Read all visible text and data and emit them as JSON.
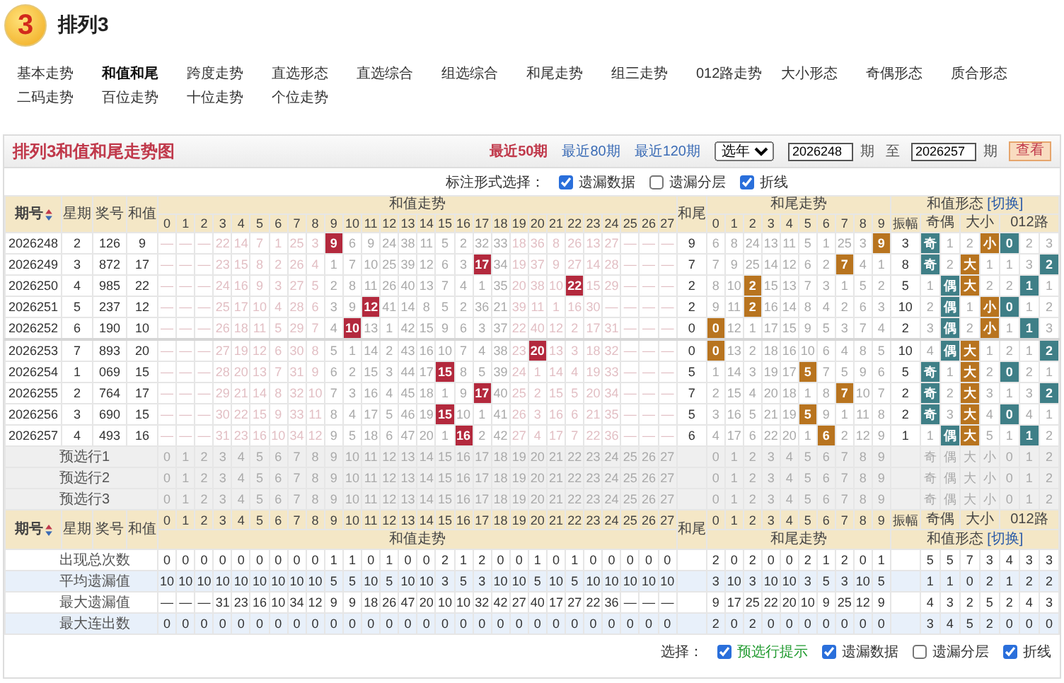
{
  "header": {
    "logo_digit": "3",
    "title": "排列3"
  },
  "nav": [
    {
      "label": "基本走势",
      "selected": false
    },
    {
      "label": "和值和尾",
      "selected": true
    },
    {
      "label": "跨度走势",
      "selected": false
    },
    {
      "label": "直选形态",
      "selected": false
    },
    {
      "label": "直选综合",
      "selected": false
    },
    {
      "label": "组选综合",
      "selected": false
    },
    {
      "label": "和尾走势",
      "selected": false
    },
    {
      "label": "组三走势",
      "selected": false
    },
    {
      "label": "012路走势",
      "selected": false
    },
    {
      "label": "大小形态",
      "selected": false
    },
    {
      "label": "奇偶形态",
      "selected": false
    },
    {
      "label": "质合形态",
      "selected": false
    },
    {
      "label": "二码走势",
      "selected": false
    },
    {
      "label": "百位走势",
      "selected": false
    },
    {
      "label": "十位走势",
      "selected": false
    },
    {
      "label": "个位走势",
      "selected": false
    }
  ],
  "panel": {
    "title": "排列3和值和尾走势图",
    "ranges": [
      {
        "label": "最近50期",
        "selected": true
      },
      {
        "label": "最近80期",
        "selected": false
      },
      {
        "label": "最近120期",
        "selected": false
      }
    ],
    "year_select": "选年",
    "from": "2026248",
    "from_unit": "期",
    "to_label": "至",
    "to": "2026257",
    "to_unit": "期",
    "query_button": "查看"
  },
  "marker_options": {
    "label": "标注形式选择：",
    "options": [
      {
        "label": "遗漏数据",
        "checked": true
      },
      {
        "label": "遗漏分层",
        "checked": false
      },
      {
        "label": "折线",
        "checked": true
      }
    ]
  },
  "table": {
    "head": {
      "issue": "期号",
      "weekday": "星期",
      "number": "奖号",
      "sum": "和值",
      "sum_group": "和值走势",
      "tail": "和尾",
      "tail_group": "和尾走势",
      "form_group": "和值形态",
      "switch_link": "[切换]",
      "span": "振幅",
      "odd_even": "奇偶",
      "big_small": "大小",
      "route": "012路",
      "sum_cols": [
        "0",
        "1",
        "2",
        "3",
        "4",
        "5",
        "6",
        "7",
        "8",
        "9",
        "10",
        "11",
        "12",
        "13",
        "14",
        "15",
        "16",
        "17",
        "18",
        "19",
        "20",
        "21",
        "22",
        "23",
        "24",
        "25",
        "26",
        "27"
      ],
      "tail_cols": [
        "0",
        "1",
        "2",
        "3",
        "4",
        "5",
        "6",
        "7",
        "8",
        "9"
      ]
    },
    "rows": [
      {
        "issue": "2026248",
        "weekday": "2",
        "number": "126",
        "sum": "9",
        "sum_cells": [
          "—",
          "—",
          "—",
          "22",
          "14",
          "7",
          "1",
          "25",
          "3",
          {
            "v": "9",
            "hit": true
          },
          "6",
          "9",
          "24",
          "38",
          "11",
          "5",
          "2",
          "32",
          "33",
          "18",
          "36",
          "8",
          "26",
          "13",
          "27",
          "—",
          "—",
          "—"
        ],
        "tail": "9",
        "tail_cells": [
          "6",
          "8",
          "24",
          "13",
          "11",
          "5",
          "1",
          "25",
          "3",
          {
            "v": "9",
            "hit": true
          }
        ],
        "span": "3",
        "form_cells": [
          {
            "v": "奇",
            "hit": true
          },
          "1",
          "2",
          {
            "v": "小",
            "hit": true
          },
          {
            "v": "0",
            "hit": true
          },
          "2",
          "3"
        ]
      },
      {
        "issue": "2026249",
        "weekday": "3",
        "number": "872",
        "sum": "17",
        "sum_cells": [
          "—",
          "—",
          "—",
          "23",
          "15",
          "8",
          "2",
          "26",
          "4",
          "1",
          "7",
          "10",
          "25",
          "39",
          "12",
          "6",
          "3",
          {
            "v": "17",
            "hit": true
          },
          "34",
          "19",
          "37",
          "9",
          "27",
          "14",
          "28",
          "—",
          "—",
          "—"
        ],
        "tail": "7",
        "tail_cells": [
          "7",
          "9",
          "25",
          "14",
          "12",
          "6",
          "2",
          {
            "v": "7",
            "hit": true
          },
          "4",
          "1"
        ],
        "span": "8",
        "form_cells": [
          {
            "v": "奇",
            "hit": true
          },
          "2",
          {
            "v": "大",
            "hit": true
          },
          "1",
          "1",
          "3",
          {
            "v": "2",
            "hit": true
          }
        ]
      },
      {
        "issue": "2026250",
        "weekday": "4",
        "number": "985",
        "sum": "22",
        "sum_cells": [
          "—",
          "—",
          "—",
          "24",
          "16",
          "9",
          "3",
          "27",
          "5",
          "2",
          "8",
          "11",
          "26",
          "40",
          "13",
          "7",
          "4",
          "1",
          "35",
          "20",
          "38",
          "10",
          {
            "v": "22",
            "hit": true
          },
          "15",
          "29",
          "—",
          "—",
          "—"
        ],
        "tail": "2",
        "tail_cells": [
          "8",
          "10",
          {
            "v": "2",
            "hit": true
          },
          "15",
          "13",
          "7",
          "3",
          "1",
          "5",
          "2"
        ],
        "span": "5",
        "form_cells": [
          "1",
          {
            "v": "偶",
            "hit": true
          },
          {
            "v": "大",
            "hit": true
          },
          "2",
          "2",
          {
            "v": "1",
            "hit": true
          },
          "1"
        ]
      },
      {
        "issue": "2026251",
        "weekday": "5",
        "number": "237",
        "sum": "12",
        "sum_cells": [
          "—",
          "—",
          "—",
          "25",
          "17",
          "10",
          "4",
          "28",
          "6",
          "3",
          "9",
          {
            "v": "12",
            "hit": true
          },
          "41",
          "14",
          "8",
          "5",
          "2",
          "36",
          "21",
          "39",
          "11",
          "1",
          "16",
          "30",
          "—",
          "—",
          "—",
          "—"
        ],
        "tail": "2",
        "tail_cells": [
          "9",
          "11",
          {
            "v": "2",
            "hit": true
          },
          "16",
          "14",
          "8",
          "4",
          "2",
          "6",
          "3"
        ],
        "span": "10",
        "form_cells": [
          "2",
          {
            "v": "偶",
            "hit": true
          },
          "1",
          {
            "v": "小",
            "hit": true
          },
          {
            "v": "0",
            "hit": true
          },
          "1",
          "2"
        ]
      },
      {
        "issue": "2026252",
        "weekday": "6",
        "number": "190",
        "sum": "10",
        "sum_cells": [
          "—",
          "—",
          "—",
          "26",
          "18",
          "11",
          "5",
          "29",
          "7",
          "4",
          {
            "v": "10",
            "hit": true
          },
          "13",
          "1",
          "42",
          "15",
          "9",
          "6",
          "3",
          "37",
          "22",
          "40",
          "12",
          "2",
          "17",
          "31",
          "—",
          "—",
          "—"
        ],
        "tail": "0",
        "tail_cells": [
          {
            "v": "0",
            "hit": true
          },
          "12",
          "1",
          "17",
          "15",
          "9",
          "5",
          "3",
          "7",
          "4"
        ],
        "span": "2",
        "form_cells": [
          "3",
          {
            "v": "偶",
            "hit": true
          },
          "2",
          {
            "v": "小",
            "hit": true
          },
          "1",
          {
            "v": "1",
            "hit": true
          },
          "3"
        ]
      },
      {
        "issue": "2026253",
        "weekday": "7",
        "number": "893",
        "sum": "20",
        "sum_cells": [
          "—",
          "—",
          "—",
          "27",
          "19",
          "12",
          "6",
          "30",
          "8",
          "5",
          "1",
          "14",
          "2",
          "43",
          "16",
          "10",
          "7",
          "4",
          "38",
          "23",
          {
            "v": "20",
            "hit": true
          },
          "13",
          "3",
          "18",
          "32",
          "—",
          "—",
          "—"
        ],
        "tail": "0",
        "tail_cells": [
          {
            "v": "0",
            "hit": true
          },
          "13",
          "2",
          "18",
          "16",
          "10",
          "6",
          "4",
          "8",
          "5"
        ],
        "span": "10",
        "form_cells": [
          "4",
          {
            "v": "偶",
            "hit": true
          },
          {
            "v": "大",
            "hit": true
          },
          "1",
          "2",
          "1",
          {
            "v": "2",
            "hit": true
          }
        ]
      },
      {
        "issue": "2026254",
        "weekday": "1",
        "number": "069",
        "sum": "15",
        "sum_cells": [
          "—",
          "—",
          "—",
          "28",
          "20",
          "13",
          "7",
          "31",
          "9",
          "6",
          "2",
          "15",
          "3",
          "44",
          "17",
          {
            "v": "15",
            "hit": true
          },
          "8",
          "5",
          "39",
          "24",
          "1",
          "14",
          "4",
          "19",
          "33",
          "—",
          "—",
          "—"
        ],
        "tail": "5",
        "tail_cells": [
          "1",
          "14",
          "3",
          "19",
          "17",
          {
            "v": "5",
            "hit": true
          },
          "7",
          "5",
          "9",
          "6"
        ],
        "span": "5",
        "form_cells": [
          {
            "v": "奇",
            "hit": true
          },
          "1",
          {
            "v": "大",
            "hit": true
          },
          "2",
          {
            "v": "0",
            "hit": true
          },
          "2",
          "1"
        ]
      },
      {
        "issue": "2026255",
        "weekday": "2",
        "number": "764",
        "sum": "17",
        "sum_cells": [
          "—",
          "—",
          "—",
          "29",
          "21",
          "14",
          "8",
          "32",
          "10",
          "7",
          "3",
          "16",
          "4",
          "45",
          "18",
          "1",
          "9",
          {
            "v": "17",
            "hit": true
          },
          "40",
          "25",
          "2",
          "15",
          "5",
          "20",
          "34",
          "—",
          "—",
          "—"
        ],
        "tail": "7",
        "tail_cells": [
          "2",
          "15",
          "4",
          "20",
          "18",
          "1",
          "8",
          {
            "v": "7",
            "hit": true
          },
          "10",
          "7"
        ],
        "span": "2",
        "form_cells": [
          {
            "v": "奇",
            "hit": true
          },
          "2",
          {
            "v": "大",
            "hit": true
          },
          "3",
          "1",
          "3",
          {
            "v": "2",
            "hit": true
          }
        ]
      },
      {
        "issue": "2026256",
        "weekday": "3",
        "number": "690",
        "sum": "15",
        "sum_cells": [
          "—",
          "—",
          "—",
          "30",
          "22",
          "15",
          "9",
          "33",
          "11",
          "8",
          "4",
          "17",
          "5",
          "46",
          "19",
          {
            "v": "15",
            "hit": true
          },
          "10",
          "1",
          "41",
          "26",
          "3",
          "16",
          "6",
          "21",
          "35",
          "—",
          "—",
          "—"
        ],
        "tail": "5",
        "tail_cells": [
          "3",
          "16",
          "5",
          "21",
          "19",
          {
            "v": "5",
            "hit": true
          },
          "9",
          "1",
          "11",
          "8"
        ],
        "span": "2",
        "form_cells": [
          {
            "v": "奇",
            "hit": true
          },
          "3",
          {
            "v": "大",
            "hit": true
          },
          "4",
          {
            "v": "0",
            "hit": true
          },
          "4",
          "1"
        ]
      },
      {
        "issue": "2026257",
        "weekday": "4",
        "number": "493",
        "sum": "16",
        "sum_cells": [
          "—",
          "—",
          "—",
          "31",
          "23",
          "16",
          "10",
          "34",
          "12",
          "9",
          "5",
          "18",
          "6",
          "47",
          "20",
          "1",
          {
            "v": "16",
            "hit": true
          },
          "2",
          "42",
          "27",
          "4",
          "17",
          "7",
          "22",
          "36",
          "—",
          "—",
          "—"
        ],
        "tail": "6",
        "tail_cells": [
          "4",
          "17",
          "6",
          "22",
          "20",
          "1",
          {
            "v": "6",
            "hit": true
          },
          "2",
          "12",
          "9"
        ],
        "span": "1",
        "form_cells": [
          "1",
          {
            "v": "偶",
            "hit": true
          },
          {
            "v": "大",
            "hit": true
          },
          "5",
          "1",
          {
            "v": "1",
            "hit": true
          },
          "2"
        ]
      }
    ],
    "preselect": [
      {
        "label": "预选行1",
        "sum_cells": [
          "0",
          "1",
          "2",
          "3",
          "4",
          "5",
          "6",
          "7",
          "8",
          "9",
          "10",
          "11",
          "12",
          "13",
          "14",
          "15",
          "16",
          "17",
          "18",
          "19",
          "20",
          "21",
          "22",
          "23",
          "24",
          "25",
          "26",
          "27"
        ],
        "tail_cells": [
          "0",
          "1",
          "2",
          "3",
          "4",
          "5",
          "6",
          "7",
          "8",
          "9"
        ],
        "form_cells": [
          "奇",
          "偶",
          "大",
          "小",
          "0",
          "1",
          "2"
        ]
      },
      {
        "label": "预选行2",
        "sum_cells": [
          "0",
          "1",
          "2",
          "3",
          "4",
          "5",
          "6",
          "7",
          "8",
          "9",
          "10",
          "11",
          "12",
          "13",
          "14",
          "15",
          "16",
          "17",
          "18",
          "19",
          "20",
          "21",
          "22",
          "23",
          "24",
          "25",
          "26",
          "27"
        ],
        "tail_cells": [
          "0",
          "1",
          "2",
          "3",
          "4",
          "5",
          "6",
          "7",
          "8",
          "9"
        ],
        "form_cells": [
          "奇",
          "偶",
          "大",
          "小",
          "0",
          "1",
          "2"
        ]
      },
      {
        "label": "预选行3",
        "sum_cells": [
          "0",
          "1",
          "2",
          "3",
          "4",
          "5",
          "6",
          "7",
          "8",
          "9",
          "10",
          "11",
          "12",
          "13",
          "14",
          "15",
          "16",
          "17",
          "18",
          "19",
          "20",
          "21",
          "22",
          "23",
          "24",
          "25",
          "26",
          "27"
        ],
        "tail_cells": [
          "0",
          "1",
          "2",
          "3",
          "4",
          "5",
          "6",
          "7",
          "8",
          "9"
        ],
        "form_cells": [
          "奇",
          "偶",
          "大",
          "小",
          "0",
          "1",
          "2"
        ]
      }
    ],
    "head_bottom": {
      "issue": "期号",
      "weekday": "星期",
      "number": "奖号",
      "sum": "和值",
      "sum_group": "和值走势",
      "tail": "和尾",
      "tail_group": "和尾走势",
      "form_group": "和值形态",
      "switch_link": "[切换]",
      "span": "振幅",
      "odd_even": "奇偶",
      "big_small": "大小",
      "route": "012路",
      "sum_cols": [
        "0",
        "1",
        "2",
        "3",
        "4",
        "5",
        "6",
        "7",
        "8",
        "9",
        "10",
        "11",
        "12",
        "13",
        "14",
        "15",
        "16",
        "17",
        "18",
        "19",
        "20",
        "21",
        "22",
        "23",
        "24",
        "25",
        "26",
        "27"
      ],
      "tail_cols": [
        "0",
        "1",
        "2",
        "3",
        "4",
        "5",
        "6",
        "7",
        "8",
        "9"
      ]
    },
    "stats": [
      {
        "label": "出现总次数",
        "sum_cells": [
          "0",
          "0",
          "0",
          "0",
          "0",
          "0",
          "0",
          "0",
          "0",
          "1",
          "1",
          "0",
          "1",
          "0",
          "0",
          "2",
          "1",
          "2",
          "0",
          "0",
          "1",
          "0",
          "1",
          "0",
          "0",
          "0",
          "0",
          "0"
        ],
        "tail_cells": [
          "2",
          "0",
          "2",
          "0",
          "0",
          "2",
          "1",
          "2",
          "0",
          "1"
        ],
        "form_cells": [
          "5",
          "5",
          "7",
          "3",
          "4",
          "3",
          "3"
        ]
      },
      {
        "label": "平均遗漏值",
        "sum_cells": [
          "10",
          "10",
          "10",
          "10",
          "10",
          "10",
          "10",
          "10",
          "10",
          "5",
          "5",
          "10",
          "5",
          "10",
          "10",
          "3",
          "5",
          "3",
          "10",
          "10",
          "5",
          "10",
          "5",
          "10",
          "10",
          "10",
          "10",
          "10"
        ],
        "tail_cells": [
          "3",
          "10",
          "3",
          "10",
          "10",
          "3",
          "5",
          "3",
          "10",
          "5"
        ],
        "form_cells": [
          "1",
          "1",
          "0",
          "2",
          "1",
          "2",
          "2"
        ]
      },
      {
        "label": "最大遗漏值",
        "sum_cells": [
          "—",
          "—",
          "—",
          "31",
          "23",
          "16",
          "10",
          "34",
          "12",
          "9",
          "9",
          "18",
          "26",
          "47",
          "20",
          "10",
          "10",
          "32",
          "42",
          "27",
          "40",
          "17",
          "27",
          "22",
          "36",
          "—",
          "—",
          "—"
        ],
        "tail_cells": [
          "9",
          "17",
          "25",
          "22",
          "20",
          "10",
          "9",
          "25",
          "12",
          "9"
        ],
        "form_cells": [
          "4",
          "3",
          "2",
          "5",
          "2",
          "4",
          "3"
        ]
      },
      {
        "label": "最大连出数",
        "sum_cells": [
          "0",
          "0",
          "0",
          "0",
          "0",
          "0",
          "0",
          "0",
          "0",
          "0",
          "0",
          "0",
          "0",
          "0",
          "0",
          "0",
          "0",
          "0",
          "0",
          "0",
          "0",
          "0",
          "0",
          "0",
          "0",
          "0",
          "0",
          "0"
        ],
        "tail_cells": [
          "2",
          "0",
          "2",
          "0",
          "0",
          "0",
          "0",
          "0",
          "0",
          "0"
        ],
        "form_cells": [
          "3",
          "4",
          "5",
          "2",
          "0",
          "0",
          "0"
        ]
      }
    ]
  },
  "footer_options": {
    "label": "选择：",
    "options": [
      {
        "label": "预选行提示",
        "checked": true,
        "kind": "hint"
      },
      {
        "label": "遗漏数据",
        "checked": true,
        "kind": "plain"
      },
      {
        "label": "遗漏分层",
        "checked": false,
        "kind": "plain"
      },
      {
        "label": "折线",
        "checked": true,
        "kind": "plain"
      }
    ]
  }
}
